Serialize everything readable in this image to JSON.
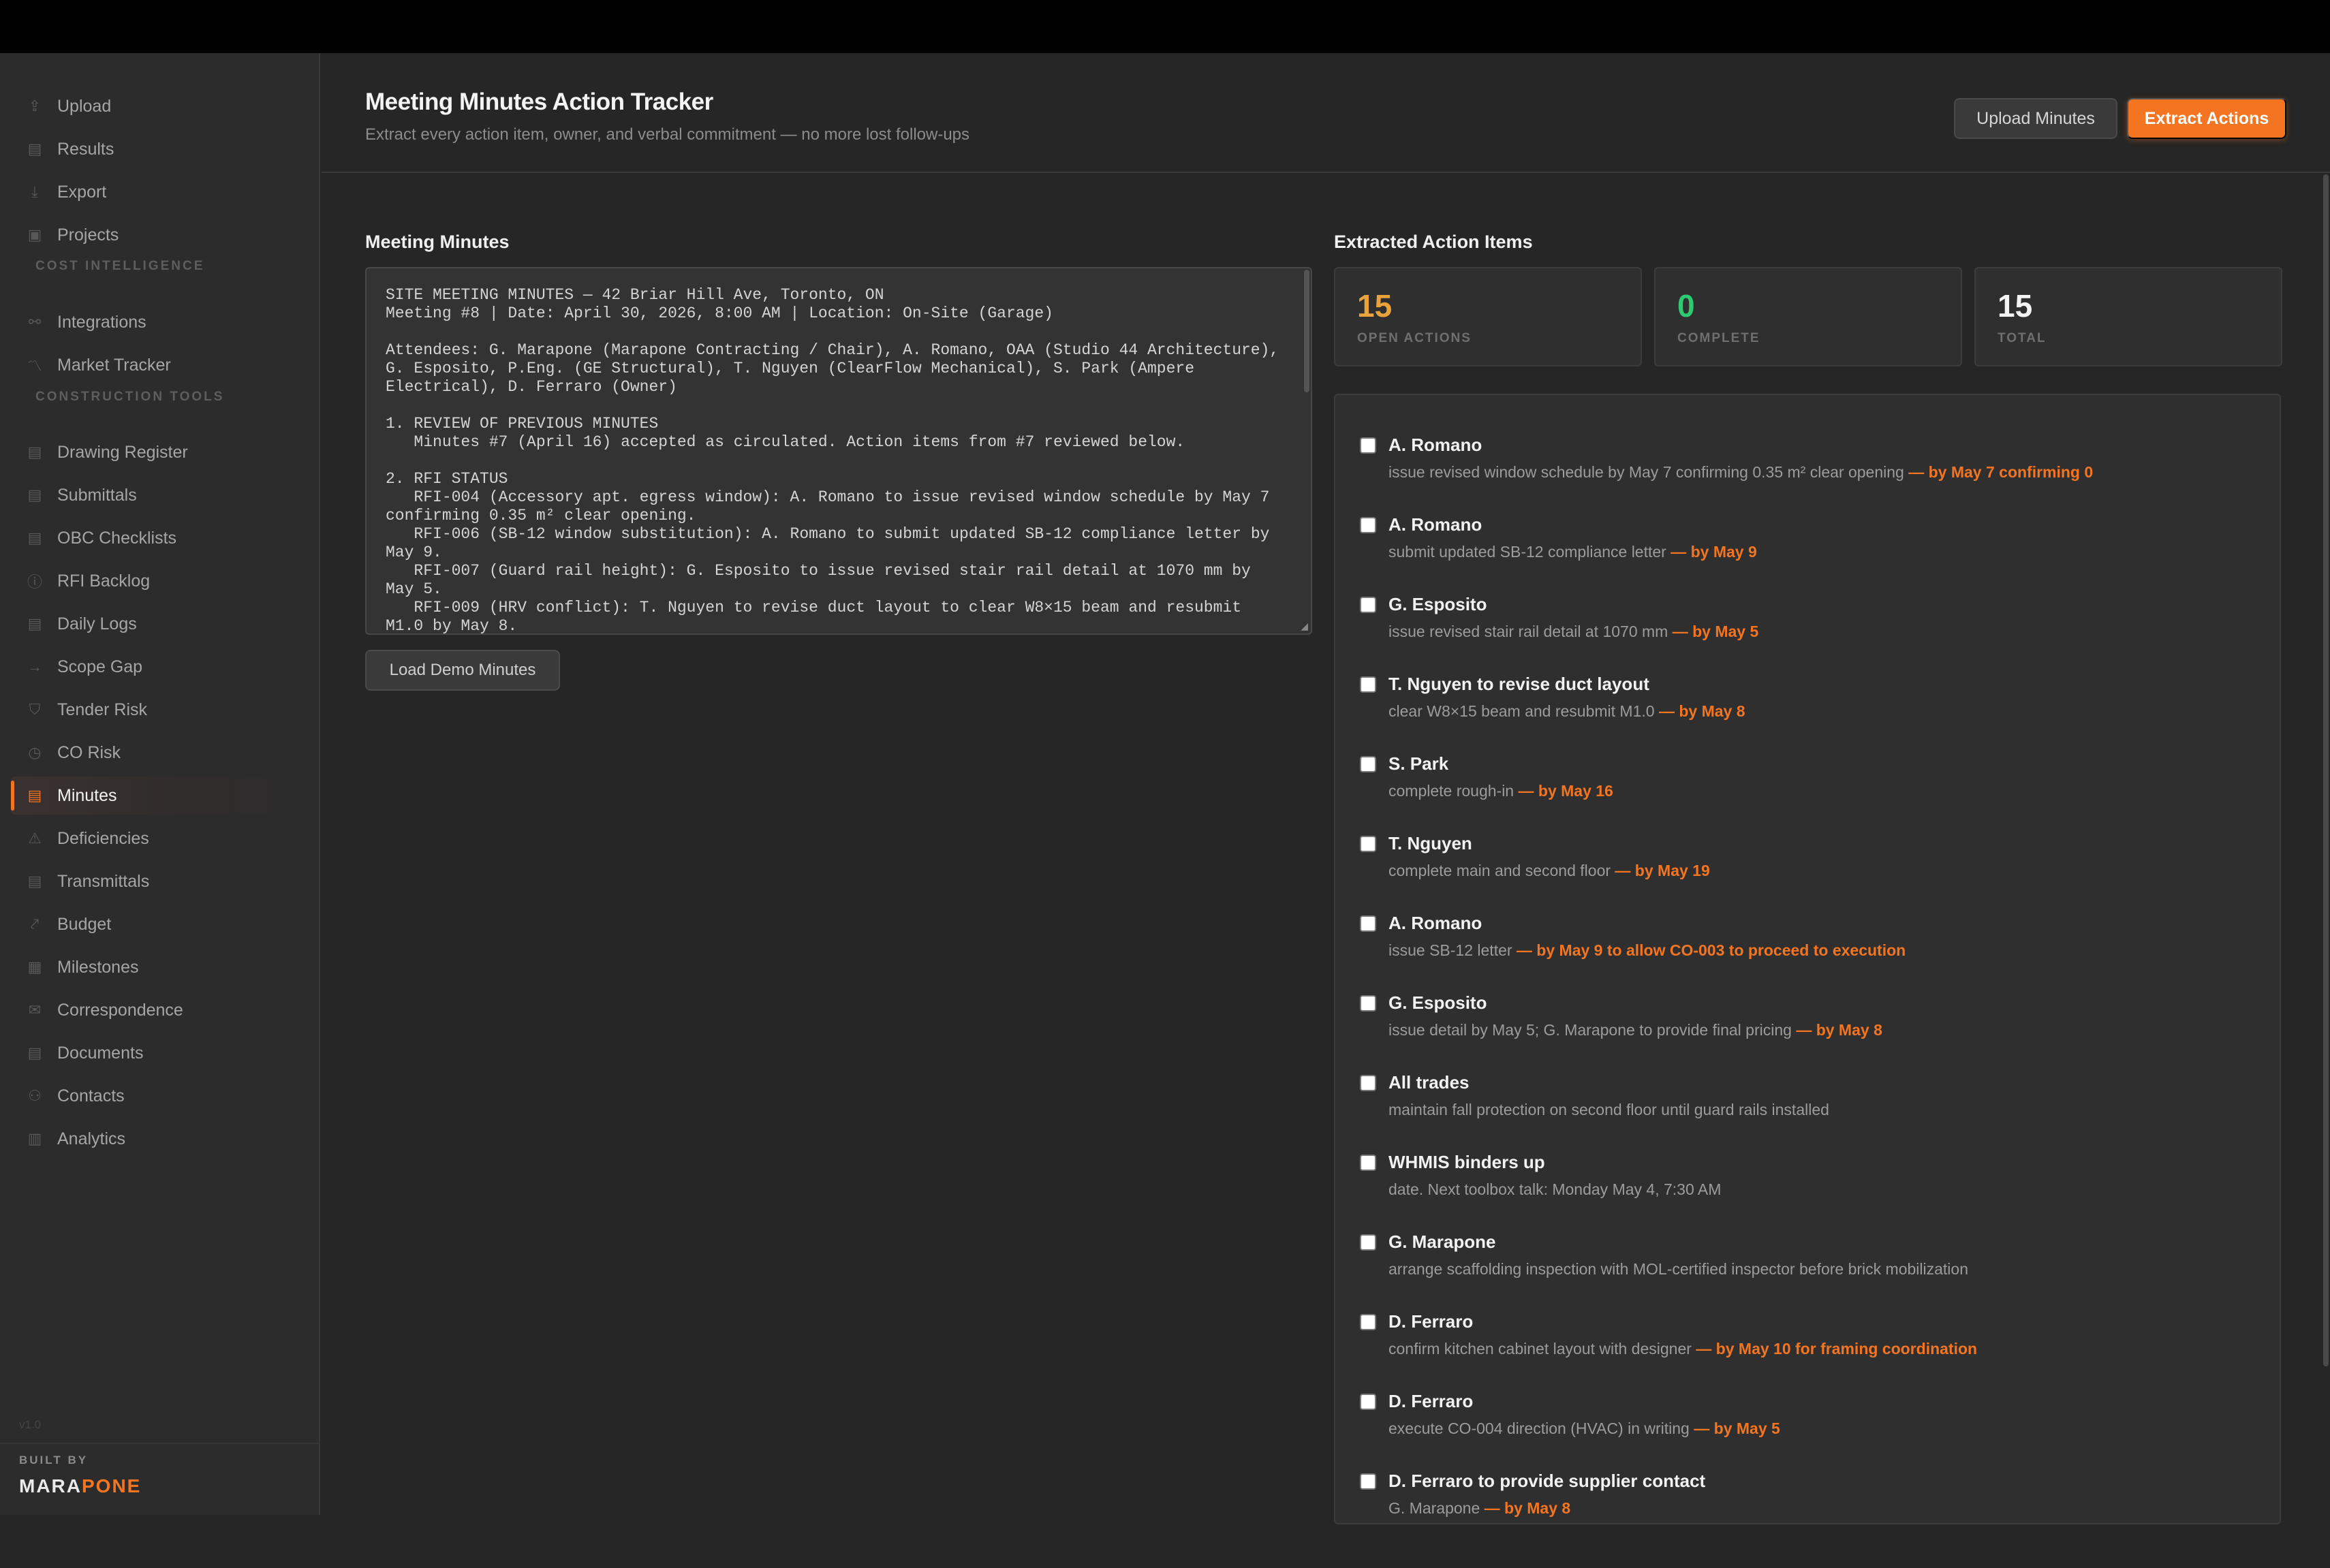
{
  "sidebar": {
    "items_top": [
      {
        "label": "Upload",
        "icon": "upload-icon",
        "glyph": "⇪"
      },
      {
        "label": "Results",
        "icon": "results-icon",
        "glyph": "▤"
      },
      {
        "label": "Export",
        "icon": "export-icon",
        "glyph": "⤓"
      },
      {
        "label": "Projects",
        "icon": "projects-icon",
        "glyph": "▣"
      }
    ],
    "section_cost": "COST INTELLIGENCE",
    "items_cost": [
      {
        "label": "Integrations",
        "icon": "integrations-icon",
        "glyph": "⚯"
      },
      {
        "label": "Market Tracker",
        "icon": "market-tracker-icon",
        "glyph": "〽"
      }
    ],
    "section_tools": "CONSTRUCTION TOOLS",
    "items_tools": [
      {
        "label": "Drawing Register",
        "icon": "drawing-register-icon",
        "glyph": "▤"
      },
      {
        "label": "Submittals",
        "icon": "submittals-icon",
        "glyph": "▤"
      },
      {
        "label": "OBC Checklists",
        "icon": "checklist-icon",
        "glyph": "▤"
      },
      {
        "label": "RFI Backlog",
        "icon": "rfi-icon",
        "glyph": "ⓘ"
      },
      {
        "label": "Daily Logs",
        "icon": "daily-logs-icon",
        "glyph": "▤"
      },
      {
        "label": "Scope Gap",
        "icon": "scope-gap-icon",
        "glyph": "→"
      },
      {
        "label": "Tender Risk",
        "icon": "tender-risk-icon",
        "glyph": "⛉"
      },
      {
        "label": "CO Risk",
        "icon": "co-risk-icon",
        "glyph": "◷"
      },
      {
        "label": "Minutes",
        "icon": "minutes-icon",
        "glyph": "▤",
        "active": true
      },
      {
        "label": "Deficiencies",
        "icon": "warning-icon",
        "glyph": "⚠"
      },
      {
        "label": "Transmittals",
        "icon": "transmittals-icon",
        "glyph": "▤"
      },
      {
        "label": "Budget",
        "icon": "budget-icon",
        "glyph": "⤤"
      },
      {
        "label": "Milestones",
        "icon": "milestones-icon",
        "glyph": "▦"
      },
      {
        "label": "Correspondence",
        "icon": "mail-icon",
        "glyph": "✉"
      },
      {
        "label": "Documents",
        "icon": "documents-icon",
        "glyph": "▤"
      },
      {
        "label": "Contacts",
        "icon": "contacts-icon",
        "glyph": "⚇"
      },
      {
        "label": "Analytics",
        "icon": "analytics-icon",
        "glyph": "▥"
      }
    ],
    "version": "v1.0",
    "built_by": "BUILT BY",
    "brand_part1": "MARA",
    "brand_part2": "PONE"
  },
  "header": {
    "title": "Meeting Minutes Action Tracker",
    "subtitle": "Extract every action item, owner, and verbal commitment — no more lost follow-ups",
    "upload_label": "Upload Minutes",
    "extract_label": "Extract Actions"
  },
  "minutes": {
    "title": "Meeting Minutes",
    "text": "SITE MEETING MINUTES — 42 Briar Hill Ave, Toronto, ON\nMeeting #8 | Date: April 30, 2026, 8:00 AM | Location: On-Site (Garage)\n\nAttendees: G. Marapone (Marapone Contracting / Chair), A. Romano, OAA (Studio 44 Architecture), G. Esposito, P.Eng. (GE Structural), T. Nguyen (ClearFlow Mechanical), S. Park (Ampere Electrical), D. Ferraro (Owner)\n\n1. REVIEW OF PREVIOUS MINUTES\n   Minutes #7 (April 16) accepted as circulated. Action items from #7 reviewed below.\n\n2. RFI STATUS\n   RFI-004 (Accessory apt. egress window): A. Romano to issue revised window schedule by May 7 confirming 0.35 m² clear opening.\n   RFI-006 (SB-12 window substitution): A. Romano to submit updated SB-12 compliance letter by May 9.\n   RFI-007 (Guard rail height): G. Esposito to issue revised stair rail detail at 1070 mm by May 5.\n   RFI-009 (HRV conflict): T. Nguyen to revise duct layout to clear W8×15 beam and resubmit M1.0 by May 8.",
    "demo_label": "Load Demo Minutes"
  },
  "actions_panel": {
    "title": "Extracted Action Items",
    "stats": [
      {
        "value": "15",
        "label": "OPEN ACTIONS",
        "color": "#e8a33d"
      },
      {
        "value": "0",
        "label": "COMPLETE",
        "color": "#2ecc71"
      },
      {
        "value": "15",
        "label": "TOTAL",
        "color": "#f4f4f4"
      }
    ],
    "items": [
      {
        "owner": "A. Romano",
        "desc": "issue revised window schedule by May 7 confirming 0.35 m² clear opening",
        "due": "— by May 7 confirming 0"
      },
      {
        "owner": "A. Romano",
        "desc": "submit updated SB-12 compliance letter",
        "due": "— by May 9"
      },
      {
        "owner": "G. Esposito",
        "desc": "issue revised stair rail detail at 1070 mm",
        "due": "— by May 5"
      },
      {
        "owner": "T. Nguyen to revise duct layout",
        "desc": "clear W8×15 beam and resubmit M1.0",
        "due": "— by May 8"
      },
      {
        "owner": "S. Park",
        "desc": "complete rough-in",
        "due": "— by May 16"
      },
      {
        "owner": "T. Nguyen",
        "desc": "complete main and second floor",
        "due": "— by May 19"
      },
      {
        "owner": "A. Romano",
        "desc": "issue SB-12 letter",
        "due": "— by May 9 to allow CO-003 to proceed to execution"
      },
      {
        "owner": "G. Esposito",
        "desc": "issue detail by May 5; G. Marapone to provide final pricing",
        "due": "— by May 8"
      },
      {
        "owner": "All trades",
        "desc": "maintain fall protection on second floor until guard rails installed",
        "due": ""
      },
      {
        "owner": "WHMIS binders up",
        "desc": "date. Next toolbox talk: Monday May 4, 7:30 AM",
        "due": ""
      },
      {
        "owner": "G. Marapone",
        "desc": "arrange scaffolding inspection with MOL-certified inspector before brick mobilization",
        "due": ""
      },
      {
        "owner": "D. Ferraro",
        "desc": "confirm kitchen cabinet layout with designer",
        "due": "— by May 10 for framing coordination"
      },
      {
        "owner": "D. Ferraro",
        "desc": "execute CO-004 direction (HVAC) in writing",
        "due": "— by May 5"
      },
      {
        "owner": "D. Ferraro to provide supplier contact",
        "desc": "G. Marapone",
        "due": "— by May 8"
      }
    ]
  }
}
